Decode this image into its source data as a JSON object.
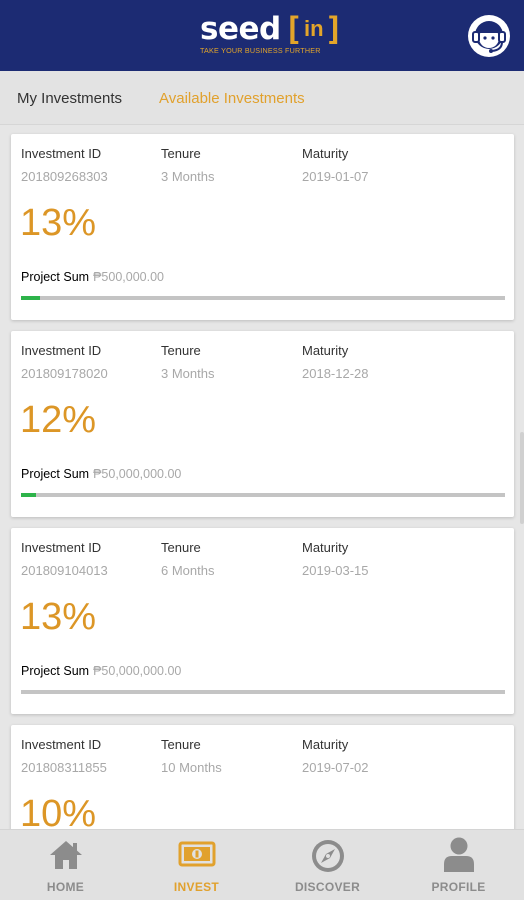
{
  "header": {
    "logo_word": "seed",
    "logo_in": "in",
    "tagline": "TAKE YOUR BUSINESS FURTHER",
    "support_icon": "customer-support-icon",
    "bar_color": "#1c2b73",
    "accent_color": "#e3a52a"
  },
  "tabs": {
    "my_investments": "My Investments",
    "available_investments": "Available Investments",
    "active": "available_investments"
  },
  "labels": {
    "investment_id": "Investment ID",
    "tenure": "Tenure",
    "maturity": "Maturity",
    "project_sum": "Project Sum"
  },
  "investments": [
    {
      "id": "201809268303",
      "tenure": "3 Months",
      "maturity": "2019-01-07",
      "rate": "13%",
      "project_sum": "₱500,000.00",
      "progress": 0.04
    },
    {
      "id": "201809178020",
      "tenure": "3 Months",
      "maturity": "2018-12-28",
      "rate": "12%",
      "project_sum": "₱50,000,000.00",
      "progress": 0.03
    },
    {
      "id": "201809104013",
      "tenure": "6 Months",
      "maturity": "2019-03-15",
      "rate": "13%",
      "project_sum": "₱50,000,000.00",
      "progress": 0.0
    },
    {
      "id": "201808311855",
      "tenure": "10 Months",
      "maturity": "2019-07-02",
      "rate": "10%"
    }
  ],
  "bottom_nav": {
    "home": "HOME",
    "invest": "INVEST",
    "discover": "DISCOVER",
    "profile": "PROFILE",
    "active": "invest"
  }
}
